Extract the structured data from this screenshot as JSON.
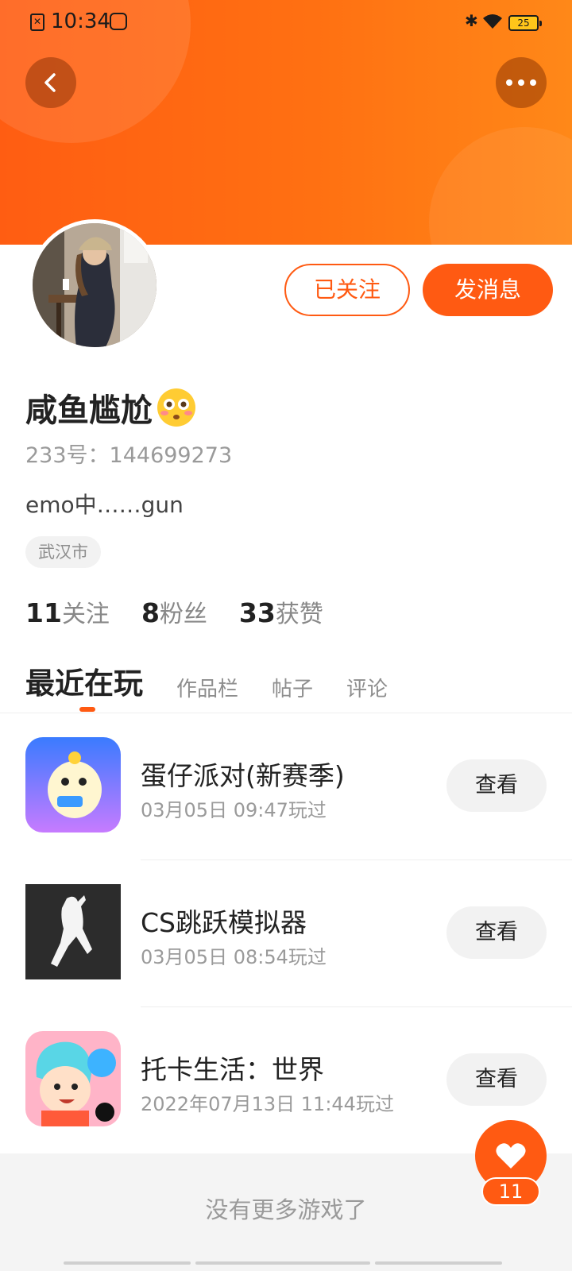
{
  "status_bar": {
    "time": "10:34",
    "battery": "25",
    "icons": [
      "sim-card-icon",
      "app-notification-icon",
      "bluetooth-icon",
      "wifi-icon",
      "battery-icon"
    ]
  },
  "header": {
    "back_icon": "chevron-left-icon",
    "more_icon": "more-dots-icon",
    "accent_color": "#ff5a12"
  },
  "actions": {
    "followed_label": "已关注",
    "message_label": "发消息"
  },
  "profile": {
    "name": "咸鱼尴尬",
    "name_emoji": "flushed-face-icon",
    "id_text": "233号：144699273",
    "bio": "emo中……gun",
    "location": "武汉市"
  },
  "stats": [
    {
      "num": "11",
      "label": "关注"
    },
    {
      "num": "8",
      "label": "粉丝"
    },
    {
      "num": "33",
      "label": "获赞"
    }
  ],
  "tabs": [
    {
      "label": "最近在玩",
      "active": true
    },
    {
      "label": "作品栏",
      "active": false
    },
    {
      "label": "帖子",
      "active": false
    },
    {
      "label": "评论",
      "active": false
    }
  ],
  "games": [
    {
      "title": "蛋仔派对(新赛季)",
      "time": "03月05日 09:47玩过",
      "button": "查看",
      "icon": "eggy-party-icon"
    },
    {
      "title": "CS跳跃模拟器",
      "time": "03月05日 08:54玩过",
      "button": "查看",
      "icon": "cs-jump-icon"
    },
    {
      "title": "托卡生活：世界",
      "time": "2022年07月13日 11:44玩过",
      "button": "查看",
      "icon": "toca-life-icon"
    }
  ],
  "footer": {
    "no_more_text": "没有更多游戏了"
  },
  "like_fab": {
    "icon": "heart-icon",
    "count": "11"
  }
}
